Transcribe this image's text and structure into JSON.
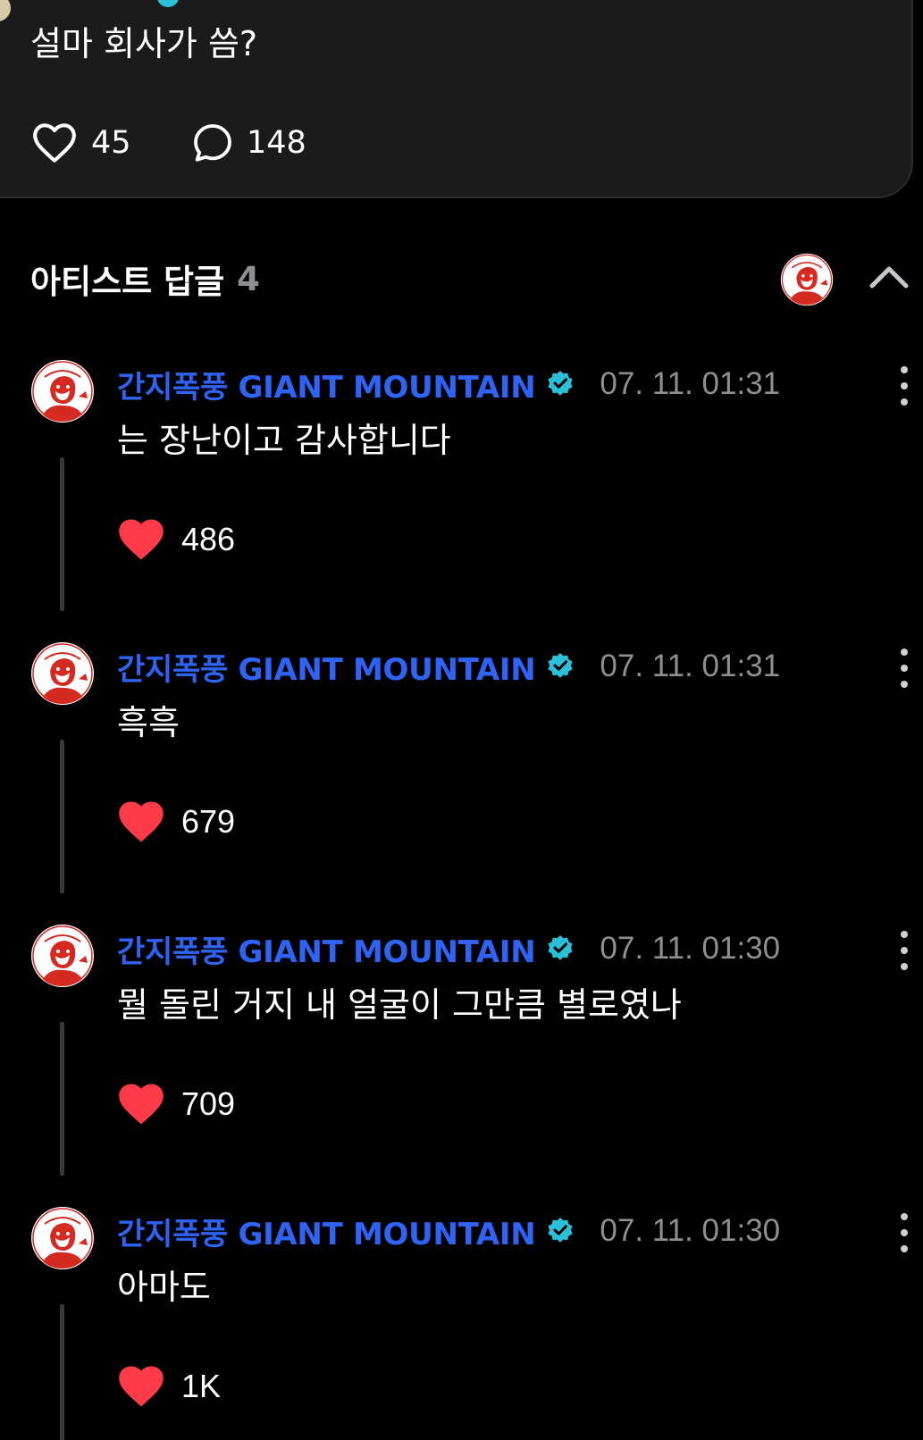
{
  "post": {
    "text": "설마 회사가 씀?",
    "likes": "45",
    "comments": "148"
  },
  "section": {
    "title": "아티스트 답글",
    "count": "4"
  },
  "colors": {
    "background": "#000000",
    "card": "#1b1b1c",
    "author": "#2f63f3",
    "verified": "#2bc0d8",
    "heart": "#ff3b4a",
    "muted": "#8e8e93"
  },
  "replies": [
    {
      "author": "간지폭풍 GIANT MOUNTAIN",
      "timestamp": "07. 11. 01:31",
      "text": "는 장난이고 감사합니다",
      "likes": "486"
    },
    {
      "author": "간지폭풍 GIANT MOUNTAIN",
      "timestamp": "07. 11. 01:31",
      "text": "흑흑",
      "likes": "679"
    },
    {
      "author": "간지폭풍 GIANT MOUNTAIN",
      "timestamp": "07. 11. 01:30",
      "text": "뭘 돌린 거지 내 얼굴이 그만큼 별로였나",
      "likes": "709"
    },
    {
      "author": "간지폭풍 GIANT MOUNTAIN",
      "timestamp": "07. 11. 01:30",
      "text": "아마도",
      "likes": "1K"
    }
  ],
  "icons": {
    "like": "heart-outline-icon",
    "comment": "speech-bubble-icon",
    "reply_like": "heart-filled-icon",
    "verified": "verified-badge-icon",
    "more": "more-vertical-icon",
    "collapse": "chevron-up-icon"
  }
}
